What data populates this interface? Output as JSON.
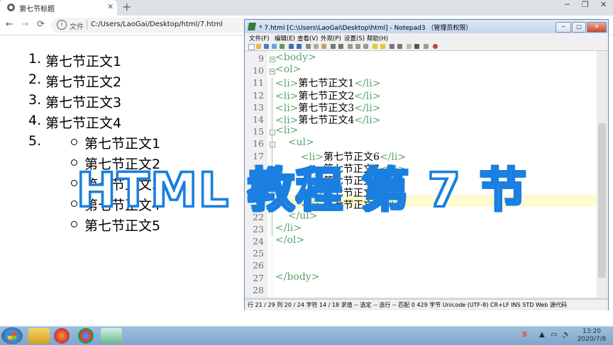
{
  "browser": {
    "tab_title": "第七节标题",
    "tab_close": "✕",
    "new_tab": "+",
    "nav": {
      "back": "←",
      "forward": "→",
      "reload": "⟳"
    },
    "info_icon": "i",
    "address_prefix": "文件",
    "url": "C:/Users/LaoGai/Desktop/html/7.html",
    "window_controls": [
      "─",
      "❐",
      "✕"
    ]
  },
  "page": {
    "ordered_list": [
      {
        "num": "1.",
        "text": "第七节正文1"
      },
      {
        "num": "2.",
        "text": "第七节正文2"
      },
      {
        "num": "3.",
        "text": "第七节正文3"
      },
      {
        "num": "4.",
        "text": "第七节正文4"
      },
      {
        "num": "5.",
        "text": ""
      }
    ],
    "nested_list": [
      "第七节正文1",
      "第七节正文2",
      "第七节正文3",
      "第七节正文4",
      "第七节正文5"
    ]
  },
  "notepad": {
    "title": "* 7.html [C:\\Users\\LaoGai\\Desktop\\html] - Notepad3 （管理员权限）",
    "menu": [
      "文件(F)",
      "编辑(E)",
      "查看(V)",
      "外观(P)",
      "设置(S)",
      "帮助(H)"
    ],
    "window_controls": [
      "─",
      "□",
      "✕"
    ],
    "line_numbers": [
      "9",
      "10",
      "11",
      "12",
      "13",
      "14",
      "15",
      "16",
      "17",
      "18",
      "19",
      "20",
      "21",
      "22",
      "23",
      "24",
      "25",
      "26",
      "27",
      "28"
    ],
    "lines": [
      {
        "indent": "",
        "open": "<body>",
        "text": "",
        "close": ""
      },
      {
        "indent": "",
        "open": "<ol>",
        "text": "",
        "close": ""
      },
      {
        "indent": "",
        "open": "<li>",
        "text": "第七节正文1",
        "close": "</li>"
      },
      {
        "indent": "",
        "open": "<li>",
        "text": "第七节正文2",
        "close": "</li>"
      },
      {
        "indent": "",
        "open": "<li>",
        "text": "第七节正文3",
        "close": "</li>"
      },
      {
        "indent": "",
        "open": "<li>",
        "text": "第七节正文4",
        "close": "</li>"
      },
      {
        "indent": "",
        "open": "<li>",
        "text": "",
        "close": ""
      },
      {
        "indent": "    ",
        "open": "<ul>",
        "text": "",
        "close": ""
      },
      {
        "indent": "        ",
        "open": "<li>",
        "text": "第七节正文6",
        "close": "</li>"
      },
      {
        "indent": "        ",
        "open": "<li>",
        "text": "第七节正文7",
        "close": "</li>"
      },
      {
        "indent": "        ",
        "open": "<li>",
        "text": "第七节正文8",
        "close": "</li>"
      },
      {
        "indent": "        ",
        "open": "<li>",
        "text": "第七节正文9",
        "close": "</li>"
      },
      {
        "indent": "        ",
        "open": "<li>",
        "text": "第七节正文0",
        "close": "</li>"
      },
      {
        "indent": "    ",
        "open": "</ul>",
        "text": "",
        "close": ""
      },
      {
        "indent": "",
        "open": "</li>",
        "text": "",
        "close": ""
      },
      {
        "indent": "",
        "open": "</ol>",
        "text": "",
        "close": ""
      },
      {
        "indent": "",
        "open": "",
        "text": "",
        "close": ""
      },
      {
        "indent": "",
        "open": "",
        "text": "",
        "close": ""
      },
      {
        "indent": "",
        "open": "</body>",
        "text": "",
        "close": ""
      },
      {
        "indent": "",
        "open": "",
        "text": "",
        "close": ""
      }
    ],
    "status": "行 21 / 29    列 20 / 24 字符  14 / 18 求值  --  选定  --  选行  --  匹配  0   429 字节  Unicode (UTF-8)  CR+LF  INS  STD  Web 源代码"
  },
  "overlay_title": "HTML 教程 第 7 节",
  "taskbar": {
    "clock_time": "13:20",
    "clock_date": "2020/7/8",
    "tray": [
      "S",
      "▲",
      "▭",
      "🔊"
    ]
  },
  "colors": {
    "tag": "#58a56a",
    "overlay_stroke": "#1a7fe0",
    "current_line": "#fffbd0"
  }
}
